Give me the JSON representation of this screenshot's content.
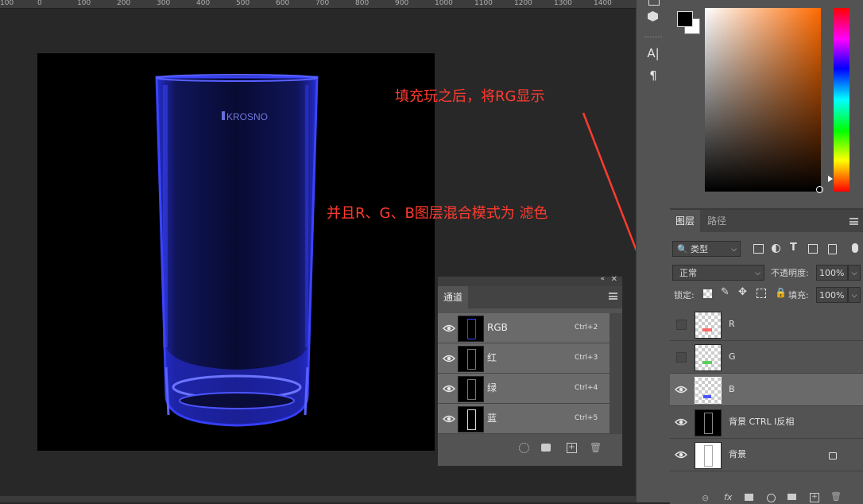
{
  "ruler": {
    "ticks": [
      "100",
      "0",
      "100",
      "200",
      "300",
      "400",
      "500",
      "600",
      "700",
      "800",
      "900",
      "1000",
      "1100",
      "1200",
      "1300",
      "1400"
    ]
  },
  "document": {
    "brand_text": "KROSNO"
  },
  "annotations": {
    "line1": "填充玩之后，将RG显示",
    "line2": "并且R、G、B图层混合模式为    滤色"
  },
  "channels_panel": {
    "tab": "通道",
    "rows": [
      {
        "name": "RGB",
        "shortcut": "Ctrl+2"
      },
      {
        "name": "红",
        "shortcut": "Ctrl+3"
      },
      {
        "name": "绿",
        "shortcut": "Ctrl+4"
      },
      {
        "name": "蓝",
        "shortcut": "Ctrl+5"
      }
    ]
  },
  "tools": {
    "type_tool": "A|",
    "paragraph_tool": "¶"
  },
  "colors": {
    "foreground": "#000000",
    "background": "#ffffff",
    "annotation": "#ff3b2f",
    "glass": "#2e35ff"
  },
  "layers_panel": {
    "tabs": [
      "图层",
      "路径"
    ],
    "filter_label": "类型",
    "blend_mode": "正常",
    "opacity_label": "不透明度:",
    "opacity_value": "100%",
    "lock_label": "锁定:",
    "fill_label": "填充:",
    "fill_value": "100%",
    "layers": [
      {
        "name": "R",
        "visible": false
      },
      {
        "name": "G",
        "visible": false
      },
      {
        "name": "B",
        "visible": true,
        "selected": true
      },
      {
        "name": "背景 CTRL I反相",
        "visible": true
      },
      {
        "name": "背景",
        "visible": true,
        "locked": true
      }
    ]
  }
}
